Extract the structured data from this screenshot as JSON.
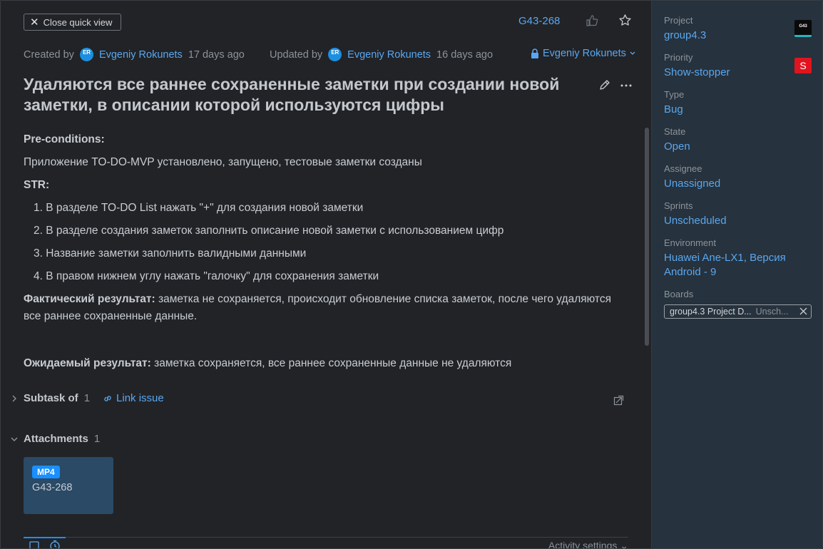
{
  "header": {
    "close_label": "Close quick view",
    "issue_id": "G43-268"
  },
  "meta": {
    "created_label": "Created by",
    "created_avatar": "ER",
    "created_by": "Evgeniy Rokunets",
    "created_ago": "17 days ago",
    "updated_label": "Updated by",
    "updated_avatar": "ER",
    "updated_by": "Evgeniy Rokunets",
    "updated_ago": "16 days ago",
    "visibility": "Evgeniy Rokunets"
  },
  "issue": {
    "title": "Удаляются все раннее сохраненные заметки при создании новой заметки, в описании которой используются цифры",
    "preconditions_label": "Pre-conditions:",
    "preconditions_text": "Приложение TO-DO-MVP установлено, запущено, тестовые заметки созданы",
    "str_label": "STR:",
    "steps": [
      "1. В разделе TO-DO List нажать \"+\" для создания новой заметки",
      "2. В разделе создания заметок заполнить описание новой заметки с использованием цифр",
      "3. Название заметки заполнить валидными данными",
      "4. В правом нижнем углу нажать \"галочку\" для сохранения заметки"
    ],
    "actual_label": "Фактический результат:",
    "actual_text": " заметка не сохраняется, происходит обновление списка заметок, после чего удаляются все раннее сохраненные данные.",
    "expected_label": "Ожидаемый результат:",
    "expected_text": " заметка сохраняется, все раннее сохраненные данные не удаляются"
  },
  "subtask": {
    "label": "Subtask of",
    "count": "1",
    "link_label": "Link issue"
  },
  "attachments": {
    "label": "Attachments",
    "count": "1",
    "items": [
      {
        "badge": "MP4",
        "name": "G43-268"
      }
    ]
  },
  "activity": {
    "settings_label": "Activity settings"
  },
  "sidebar": {
    "project_label": "Project",
    "project_value": "group4.3",
    "project_logo": "G43",
    "priority_label": "Priority",
    "priority_value": "Show-stopper",
    "priority_badge": "S",
    "type_label": "Type",
    "type_value": "Bug",
    "state_label": "State",
    "state_value": "Open",
    "assignee_label": "Assignee",
    "assignee_value": "Unassigned",
    "sprints_label": "Sprints",
    "sprints_value": "Unscheduled",
    "environment_label": "Environment",
    "environment_value": "Huawei Ane-LX1, Версия Android - 9",
    "boards_label": "Boards",
    "board_name": "group4.3 Project D...",
    "board_sprint": "Unsch..."
  },
  "colors": {
    "accent": "#5aa7ef",
    "background": "#212327",
    "sidebar": "#26323d",
    "priority": "#e0141e",
    "badge": "#1a8fff"
  }
}
